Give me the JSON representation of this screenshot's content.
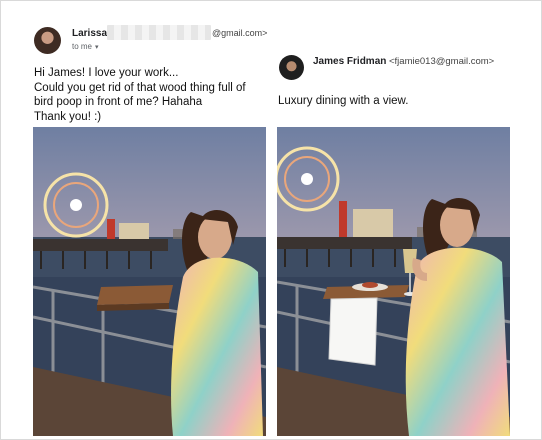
{
  "left_email": {
    "sender_name": "Larissa",
    "sender_email_tail": "@gmail.com>",
    "recipient_line": "to me",
    "body_lines": [
      "Hi James! I love your work...",
      "Could you get rid of that wood thing full of",
      "bird poop in front of me? Hahaha",
      "Thank you! :)"
    ]
  },
  "right_email": {
    "sender_name": "James Fridman",
    "sender_email": "<fjamie013@gmail.com>",
    "body": "Luxury dining with a view."
  },
  "icons": {
    "recipient_dropdown": "chevron-down-icon"
  },
  "colors": {
    "sky_top": "#6f7fa2",
    "sky_bottom": "#d8bdb6",
    "water": "#3d4c63",
    "dress_pink": "#efb2b8",
    "dress_teal": "#8fd1c8",
    "dress_yellow": "#f1dc7b"
  }
}
